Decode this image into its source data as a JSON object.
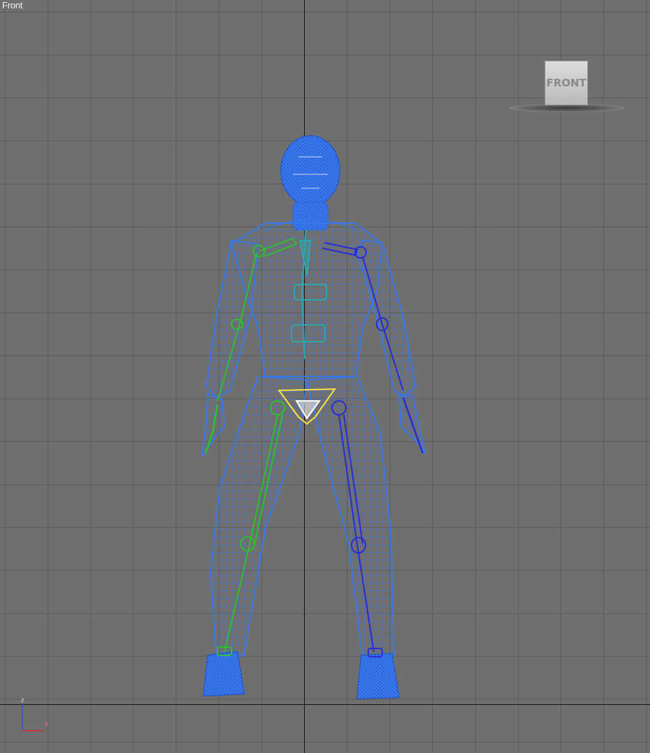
{
  "viewport": {
    "label": "Front",
    "grid": true
  },
  "viewcube": {
    "face_label": "FRONT"
  },
  "axis_tripod": {
    "z_label": "z",
    "x_label": "x"
  },
  "colors": {
    "background": "#6f6f6f",
    "grid": "#5a5a5a",
    "mesh": "#2f6ee0",
    "mesh_dense": "#2a62d6",
    "bone_left": "#2fbf2f",
    "bone_right": "#2a2ad8",
    "spine": "#2aaab0",
    "pelvis": "#ffe24a"
  }
}
